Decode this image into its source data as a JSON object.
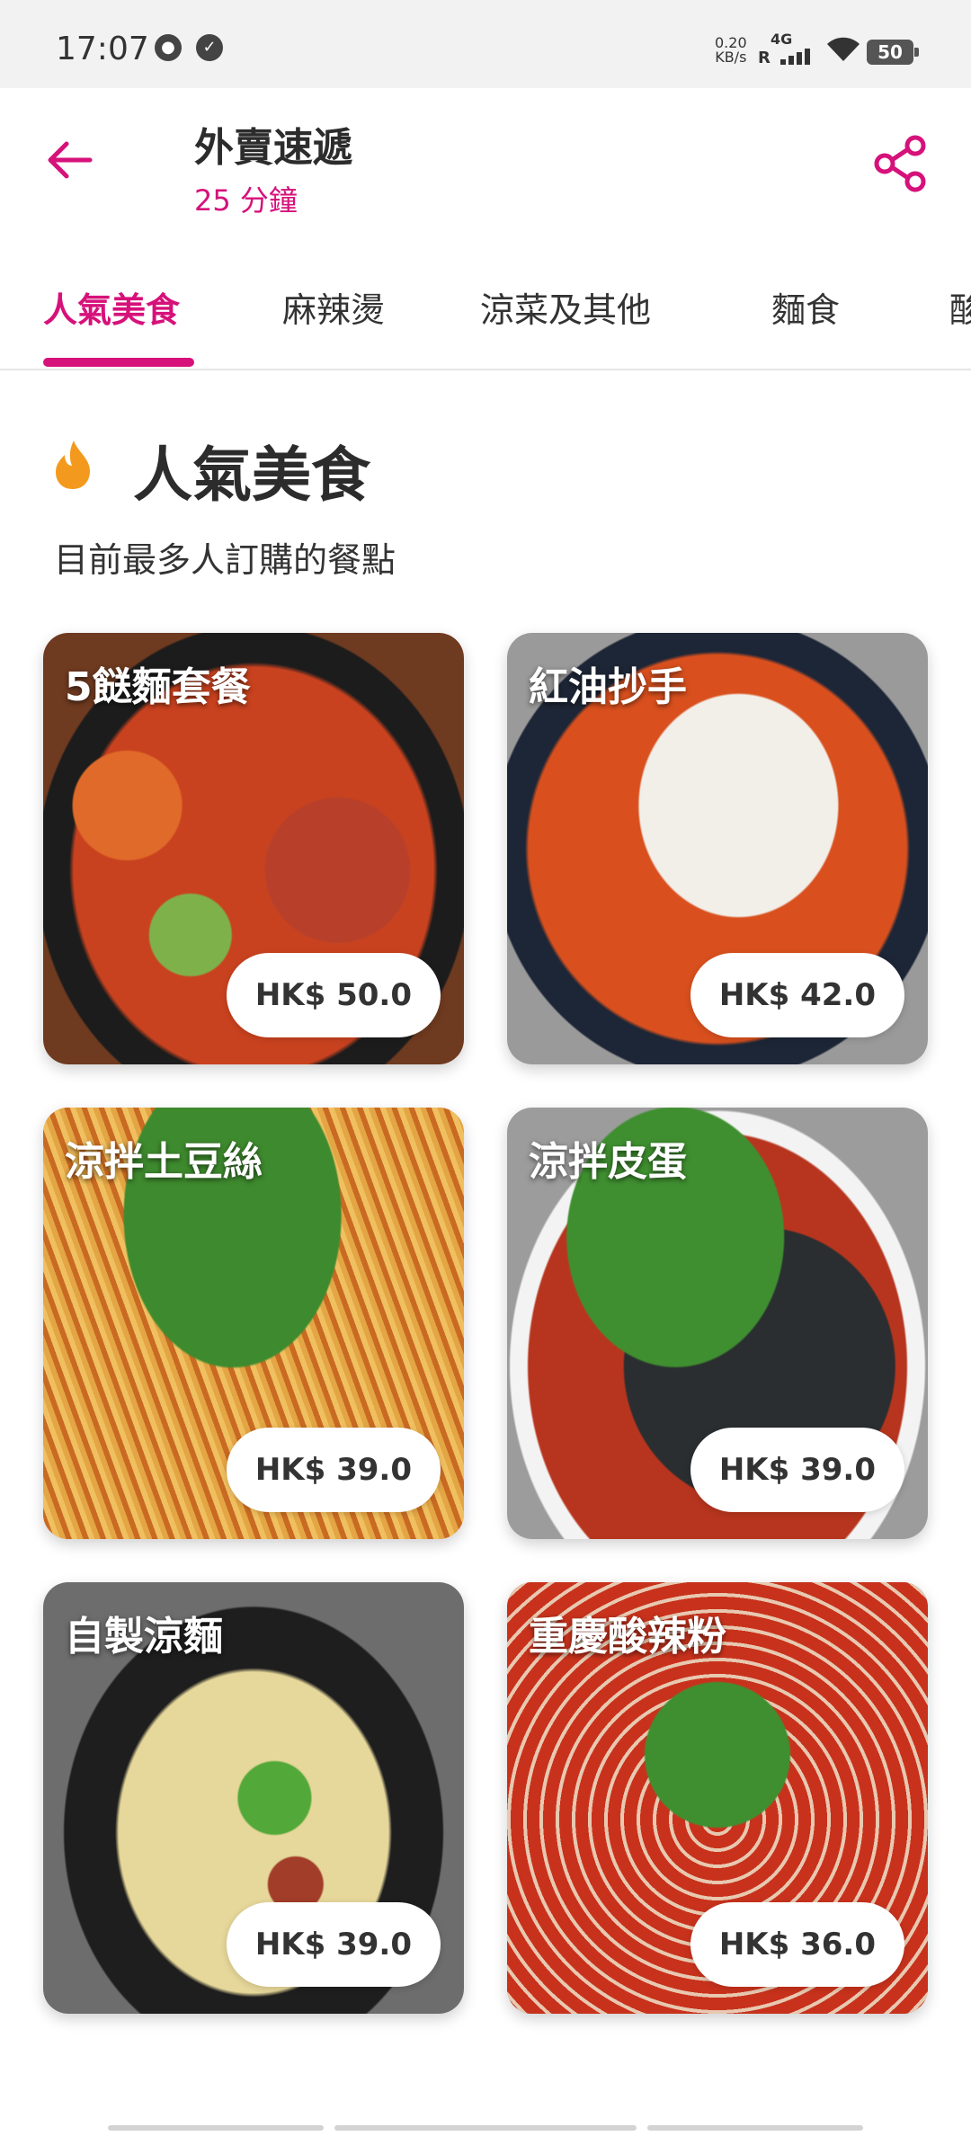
{
  "status_bar": {
    "time": "17:07",
    "net_speed_value": "0.20",
    "net_speed_unit": "KB/s",
    "network": "4G",
    "roaming": "R",
    "battery": "50",
    "icons": [
      "wechat-icon",
      "check-badge-icon",
      "signal-icon",
      "wifi-icon",
      "battery-icon"
    ]
  },
  "header": {
    "title": "外賣速遞",
    "eta": "25 分鐘",
    "back_icon": "arrow-left-icon",
    "share_icon": "share-icon"
  },
  "tabs": [
    {
      "label": "人氣美食",
      "active": true
    },
    {
      "label": "麻辣燙",
      "active": false
    },
    {
      "label": "涼菜及其他",
      "active": false
    },
    {
      "label": "麵食",
      "active": false
    },
    {
      "label": "酸",
      "active": false
    }
  ],
  "section": {
    "title": "人氣美食",
    "subtitle": "目前最多人訂購的餐點",
    "icon": "flame-icon"
  },
  "items": [
    {
      "name": "5餸麵套餐",
      "price": "HK$ 50.0"
    },
    {
      "name": "紅油抄手",
      "price": "HK$ 42.0"
    },
    {
      "name": "涼拌土豆絲",
      "price": "HK$ 39.0"
    },
    {
      "name": "涼拌皮蛋",
      "price": "HK$ 39.0"
    },
    {
      "name": "自製涼麵",
      "price": "HK$ 39.0"
    },
    {
      "name": "重慶酸辣粉",
      "price": "HK$ 36.0"
    }
  ],
  "colors": {
    "accent": "#d6117a",
    "flame": "#f39a1e"
  }
}
